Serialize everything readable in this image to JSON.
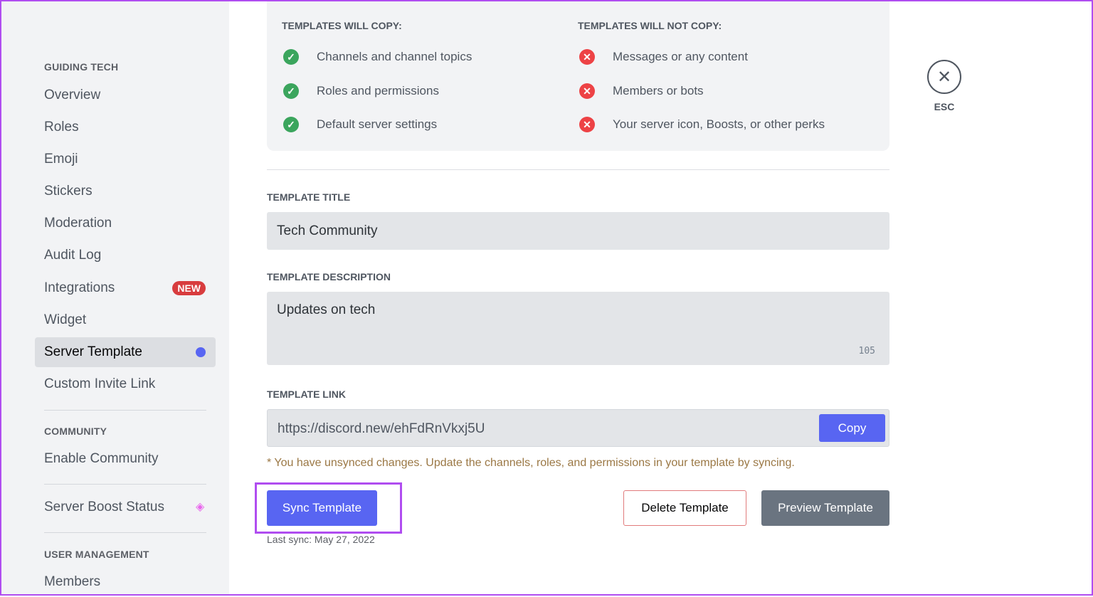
{
  "sidebar": {
    "section1": "GUIDING TECH",
    "items": [
      "Overview",
      "Roles",
      "Emoji",
      "Stickers",
      "Moderation",
      "Audit Log",
      "Integrations",
      "Widget",
      "Server Template",
      "Custom Invite Link"
    ],
    "new_badge": "NEW",
    "section2": "COMMUNITY",
    "enable_community": "Enable Community",
    "server_boost": "Server Boost Status",
    "section3": "USER MANAGEMENT",
    "members": "Members",
    "selected": "Server Template"
  },
  "info": {
    "will_copy_title": "TEMPLATES WILL COPY:",
    "will_copy": [
      "Channels and channel topics",
      "Roles and permissions",
      "Default server settings"
    ],
    "will_not_copy_title": "TEMPLATES WILL NOT COPY:",
    "will_not_copy": [
      "Messages or any content",
      "Members or bots",
      "Your server icon, Boosts, or other perks"
    ]
  },
  "form": {
    "title_label": "TEMPLATE TITLE",
    "title_value": "Tech Community",
    "desc_label": "TEMPLATE DESCRIPTION",
    "desc_value": "Updates on tech",
    "desc_count": "105",
    "link_label": "TEMPLATE LINK",
    "link_value": "https://discord.new/ehFdRnVkxj5U",
    "copy": "Copy",
    "note": "* You have unsynced changes. Update the channels, roles, and permissions in your template by syncing.",
    "sync": "Sync Template",
    "delete": "Delete Template",
    "preview": "Preview Template",
    "last_sync": "Last sync: May 27, 2022"
  },
  "close": {
    "label": "ESC",
    "icon": "close-icon"
  },
  "colors": {
    "accent": "#5865f2",
    "danger": "#ed4245",
    "success": "#3ba55d",
    "highlight": "#b04df0"
  }
}
